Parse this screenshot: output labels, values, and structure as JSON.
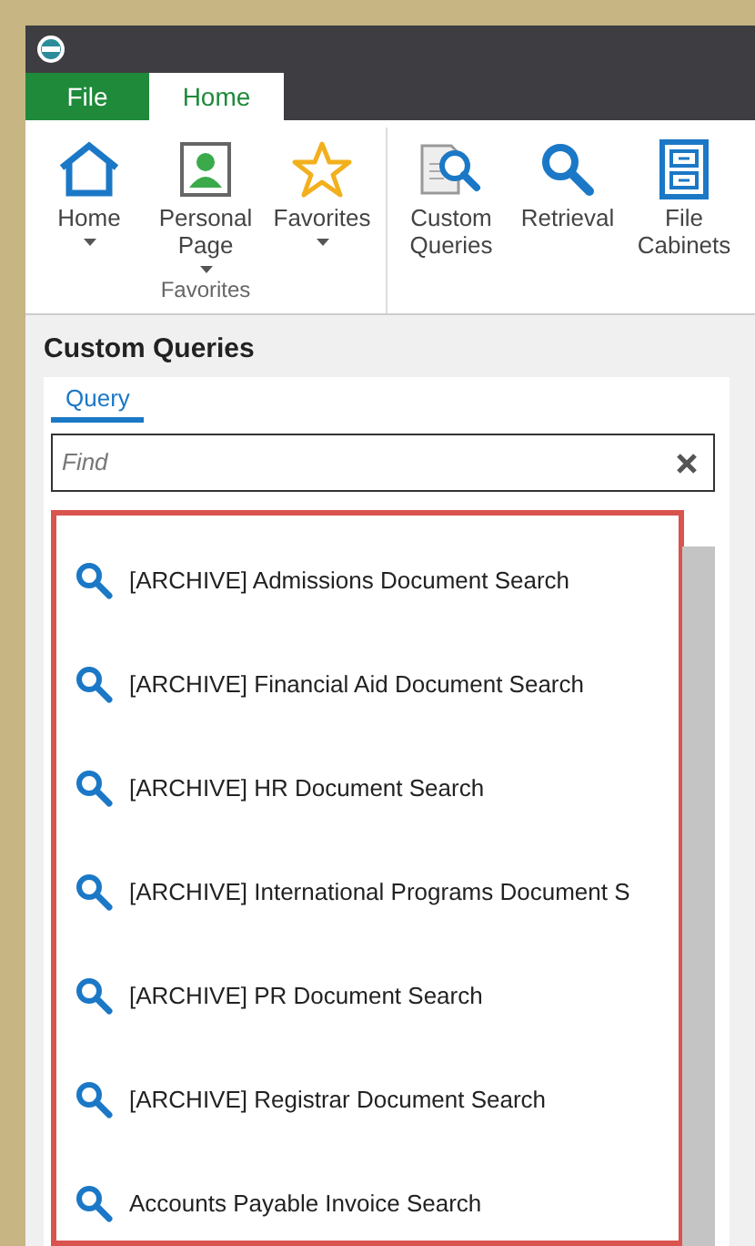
{
  "tabs": [
    {
      "label": "File",
      "kind": "file",
      "selected": false
    },
    {
      "label": "Home",
      "kind": "tab",
      "selected": true
    }
  ],
  "ribbon": {
    "groups": [
      {
        "label": "Favorites",
        "buttons": [
          {
            "label": "Home",
            "dropdown": true
          },
          {
            "label": "Personal Page",
            "dropdown": true
          },
          {
            "label": "Favorites",
            "dropdown": true
          }
        ]
      },
      {
        "buttons": [
          {
            "label": "Custom Queries",
            "dropdown": false
          },
          {
            "label": "Retrieval",
            "dropdown": false
          },
          {
            "label": "File Cabinets",
            "dropdown": false
          }
        ]
      }
    ]
  },
  "panel": {
    "title": "Custom Queries",
    "tabs": [
      {
        "label": "Query",
        "selected": true
      }
    ],
    "search": {
      "placeholder": "Find"
    },
    "items": [
      {
        "label": "[ARCHIVE] Admissions Document Search"
      },
      {
        "label": "[ARCHIVE] Financial Aid Document Search"
      },
      {
        "label": "[ARCHIVE] HR Document Search"
      },
      {
        "label": "[ARCHIVE] International Programs Document S"
      },
      {
        "label": "[ARCHIVE] PR Document Search"
      },
      {
        "label": "[ARCHIVE] Registrar Document Search"
      },
      {
        "label": "Accounts Payable Invoice Search"
      }
    ]
  }
}
